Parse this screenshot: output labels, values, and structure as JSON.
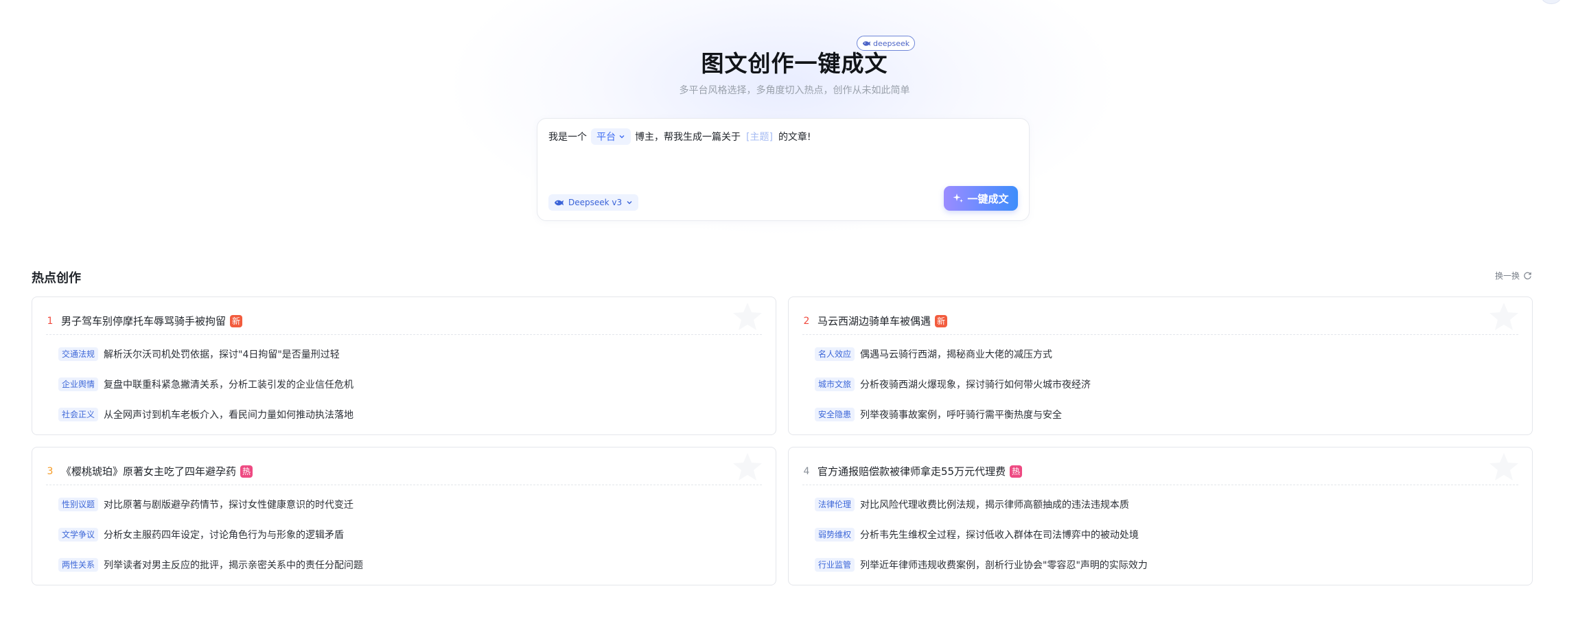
{
  "hero": {
    "title": "图文创作一键成文",
    "badge": "deepseek",
    "subtitle": "多平台风格选择，多角度切入热点，创作从未如此简单"
  },
  "composer": {
    "prefix": "我是一个",
    "platform_label": "平台",
    "middle": "博主，帮我生成一篇关于",
    "topic_placeholder": "[主题]",
    "suffix": "的文章!",
    "model_label": "Deepseek v3",
    "generate_label": "一键成文"
  },
  "hot": {
    "title": "热点创作",
    "refresh_label": "换一换",
    "cards": [
      {
        "num": "1",
        "title": "男子驾车别停摩托车辱骂骑手被拘留",
        "badge": "新",
        "angles": [
          {
            "tag": "交通法规",
            "text": "解析沃尔沃司机处罚依据，探讨\"4日拘留\"是否量刑过轻"
          },
          {
            "tag": "企业舆情",
            "text": "复盘中联重科紧急撇清关系，分析工装引发的企业信任危机"
          },
          {
            "tag": "社会正义",
            "text": "从全网声讨到机车老板介入，看民间力量如何推动执法落地"
          }
        ]
      },
      {
        "num": "2",
        "title": "马云西湖边骑单车被偶遇",
        "badge": "新",
        "angles": [
          {
            "tag": "名人效应",
            "text": "偶遇马云骑行西湖，揭秘商业大佬的减压方式"
          },
          {
            "tag": "城市文旅",
            "text": "分析夜骑西湖火爆现象，探讨骑行如何带火城市夜经济"
          },
          {
            "tag": "安全隐患",
            "text": "列举夜骑事故案例，呼吁骑行需平衡热度与安全"
          }
        ]
      },
      {
        "num": "3",
        "title": "《樱桃琥珀》原著女主吃了四年避孕药",
        "badge": "热",
        "angles": [
          {
            "tag": "性别议题",
            "text": "对比原著与剧版避孕药情节，探讨女性健康意识的时代变迁"
          },
          {
            "tag": "文学争议",
            "text": "分析女主服药四年设定，讨论角色行为与形象的逻辑矛盾"
          },
          {
            "tag": "两性关系",
            "text": "列举读者对男主反应的批评，揭示亲密关系中的责任分配问题"
          }
        ]
      },
      {
        "num": "4",
        "title": "官方通报赔偿款被律师拿走55万元代理费",
        "badge": "热",
        "angles": [
          {
            "tag": "法律伦理",
            "text": "对比风险代理收费比例法规，揭示律师高额抽成的违法违规本质"
          },
          {
            "tag": "弱势维权",
            "text": "分析韦先生维权全过程，探讨低收入群体在司法博弈中的被动处境"
          },
          {
            "tag": "行业监管",
            "text": "列举近年律师违规收费案例，剖析行业协会\"零容忍\"声明的实际效力"
          }
        ]
      }
    ]
  },
  "colors": {
    "accent": "#3f6df2",
    "rank_red": "#f04a3e",
    "rank_orange": "#f59a23",
    "badge_new": "#f25c3e",
    "badge_hot": "#ee4a82"
  }
}
